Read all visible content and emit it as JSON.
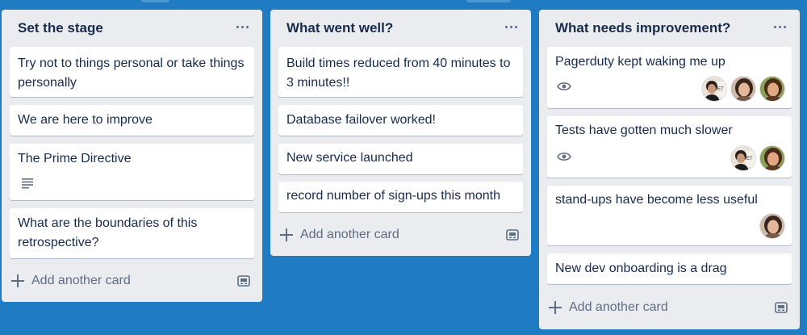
{
  "lists": [
    {
      "title": "Set the stage",
      "cards": [
        {
          "text": "Try not to things personal or take things personally"
        },
        {
          "text": "We are here to improve"
        },
        {
          "text": "The Prime Directive",
          "badges": [
            "description-icon"
          ]
        },
        {
          "text": "What are the boundaries of this retrospective?"
        }
      ],
      "add_label": "Add another card"
    },
    {
      "title": "What went well?",
      "cards": [
        {
          "text": "Build times reduced from 40 minutes to 3 minutes!!"
        },
        {
          "text": "Database failover worked!"
        },
        {
          "text": "New service launched"
        },
        {
          "text": "record number of sign-ups this month"
        }
      ],
      "add_label": "Add another card"
    },
    {
      "title": "What needs improvement?",
      "cards": [
        {
          "text": "Pagerduty kept waking me up",
          "badges": [
            "eye-icon"
          ],
          "members": [
            "avatar-man-poster",
            "avatar-woman-1",
            "avatar-woman-2"
          ]
        },
        {
          "text": "Tests have gotten much slower",
          "badges": [
            "eye-icon"
          ],
          "members": [
            "avatar-man-poster",
            "avatar-woman-2"
          ]
        },
        {
          "text": "stand-ups have become less useful",
          "members": [
            "avatar-woman-1"
          ]
        },
        {
          "text": "New dev onboarding is a drag"
        }
      ],
      "add_label": "Add another card"
    }
  ],
  "colors": {
    "board_background": "#1f7cc2",
    "list_background": "#ebecf0",
    "card_background": "#ffffff",
    "title_text": "#172b4d",
    "muted_text": "#5e6c84"
  }
}
